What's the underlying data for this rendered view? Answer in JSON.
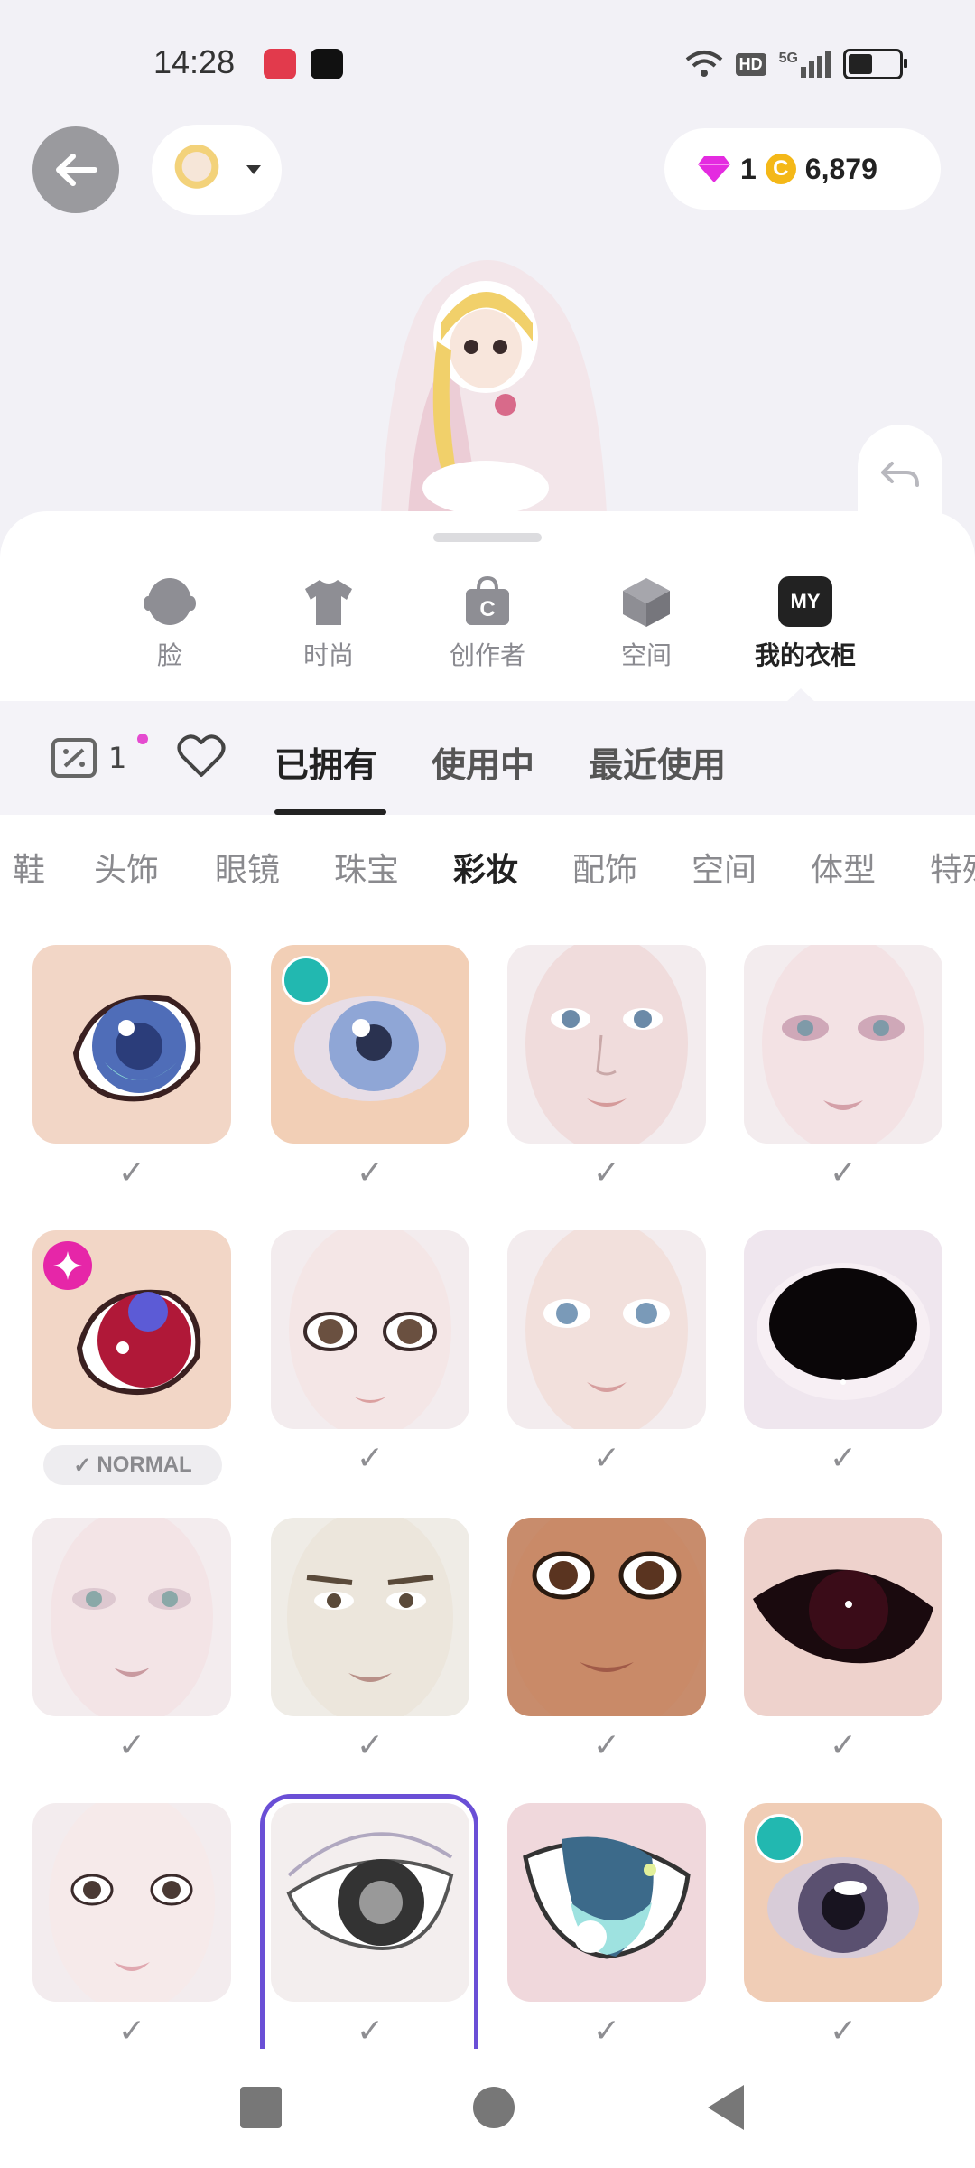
{
  "status_bar": {
    "time": "14:28",
    "network": "5G",
    "hd": "HD",
    "battery_level": 0.55
  },
  "header": {
    "gems": "1",
    "coins": "6,879"
  },
  "main_tabs": [
    {
      "label": "脸",
      "icon": "face-icon"
    },
    {
      "label": "时尚",
      "icon": "tshirt-icon"
    },
    {
      "label": "创作者",
      "icon": "creator-bag-icon"
    },
    {
      "label": "空间",
      "icon": "cube-icon"
    },
    {
      "label": "我的衣柜",
      "icon": "my-wardrobe-icon",
      "icon_text": "MY",
      "active": true
    }
  ],
  "sub_tabs": {
    "coupon_count": "1",
    "items": [
      "已拥有",
      "使用中",
      "最近使用"
    ],
    "active": "已拥有"
  },
  "categories": [
    "鞋",
    "头饰",
    "眼镜",
    "珠宝",
    "彩妆",
    "配饰",
    "空间",
    "体型",
    "特殊"
  ],
  "active_category": "彩妆",
  "grid": {
    "normal_tag": "NORMAL",
    "items": [
      {
        "kind": "eye",
        "name": "blue-anime-eye",
        "status": "✓"
      },
      {
        "kind": "eye",
        "name": "blue-eye-teal-badge",
        "status": "✓"
      },
      {
        "kind": "face",
        "name": "face-blue-eyes",
        "status": "✓"
      },
      {
        "kind": "face",
        "name": "face-pale-makeup",
        "status": "✓"
      },
      {
        "kind": "eye",
        "name": "red-anime-eye-star-badge",
        "status": "NORMAL"
      },
      {
        "kind": "face",
        "name": "face-brown-eyes",
        "status": "✓"
      },
      {
        "kind": "face",
        "name": "face-light-blue-eyes",
        "status": "✓"
      },
      {
        "kind": "eye",
        "name": "black-eye",
        "status": "✓"
      },
      {
        "kind": "face",
        "name": "face-gray-eyes",
        "status": "✓"
      },
      {
        "kind": "face",
        "name": "face-male",
        "status": "✓"
      },
      {
        "kind": "face",
        "name": "face-tan-cartoon",
        "status": "✓"
      },
      {
        "kind": "eye",
        "name": "dark-red-eye",
        "status": "✓"
      },
      {
        "kind": "face",
        "name": "face-doll",
        "status": "✓"
      },
      {
        "kind": "eye",
        "name": "sketch-eye-selected",
        "status": "✓"
      },
      {
        "kind": "eye",
        "name": "teal-anime-eye",
        "status": "✓"
      },
      {
        "kind": "eye",
        "name": "purple-eye-teal-badge",
        "status": "✓"
      }
    ]
  }
}
